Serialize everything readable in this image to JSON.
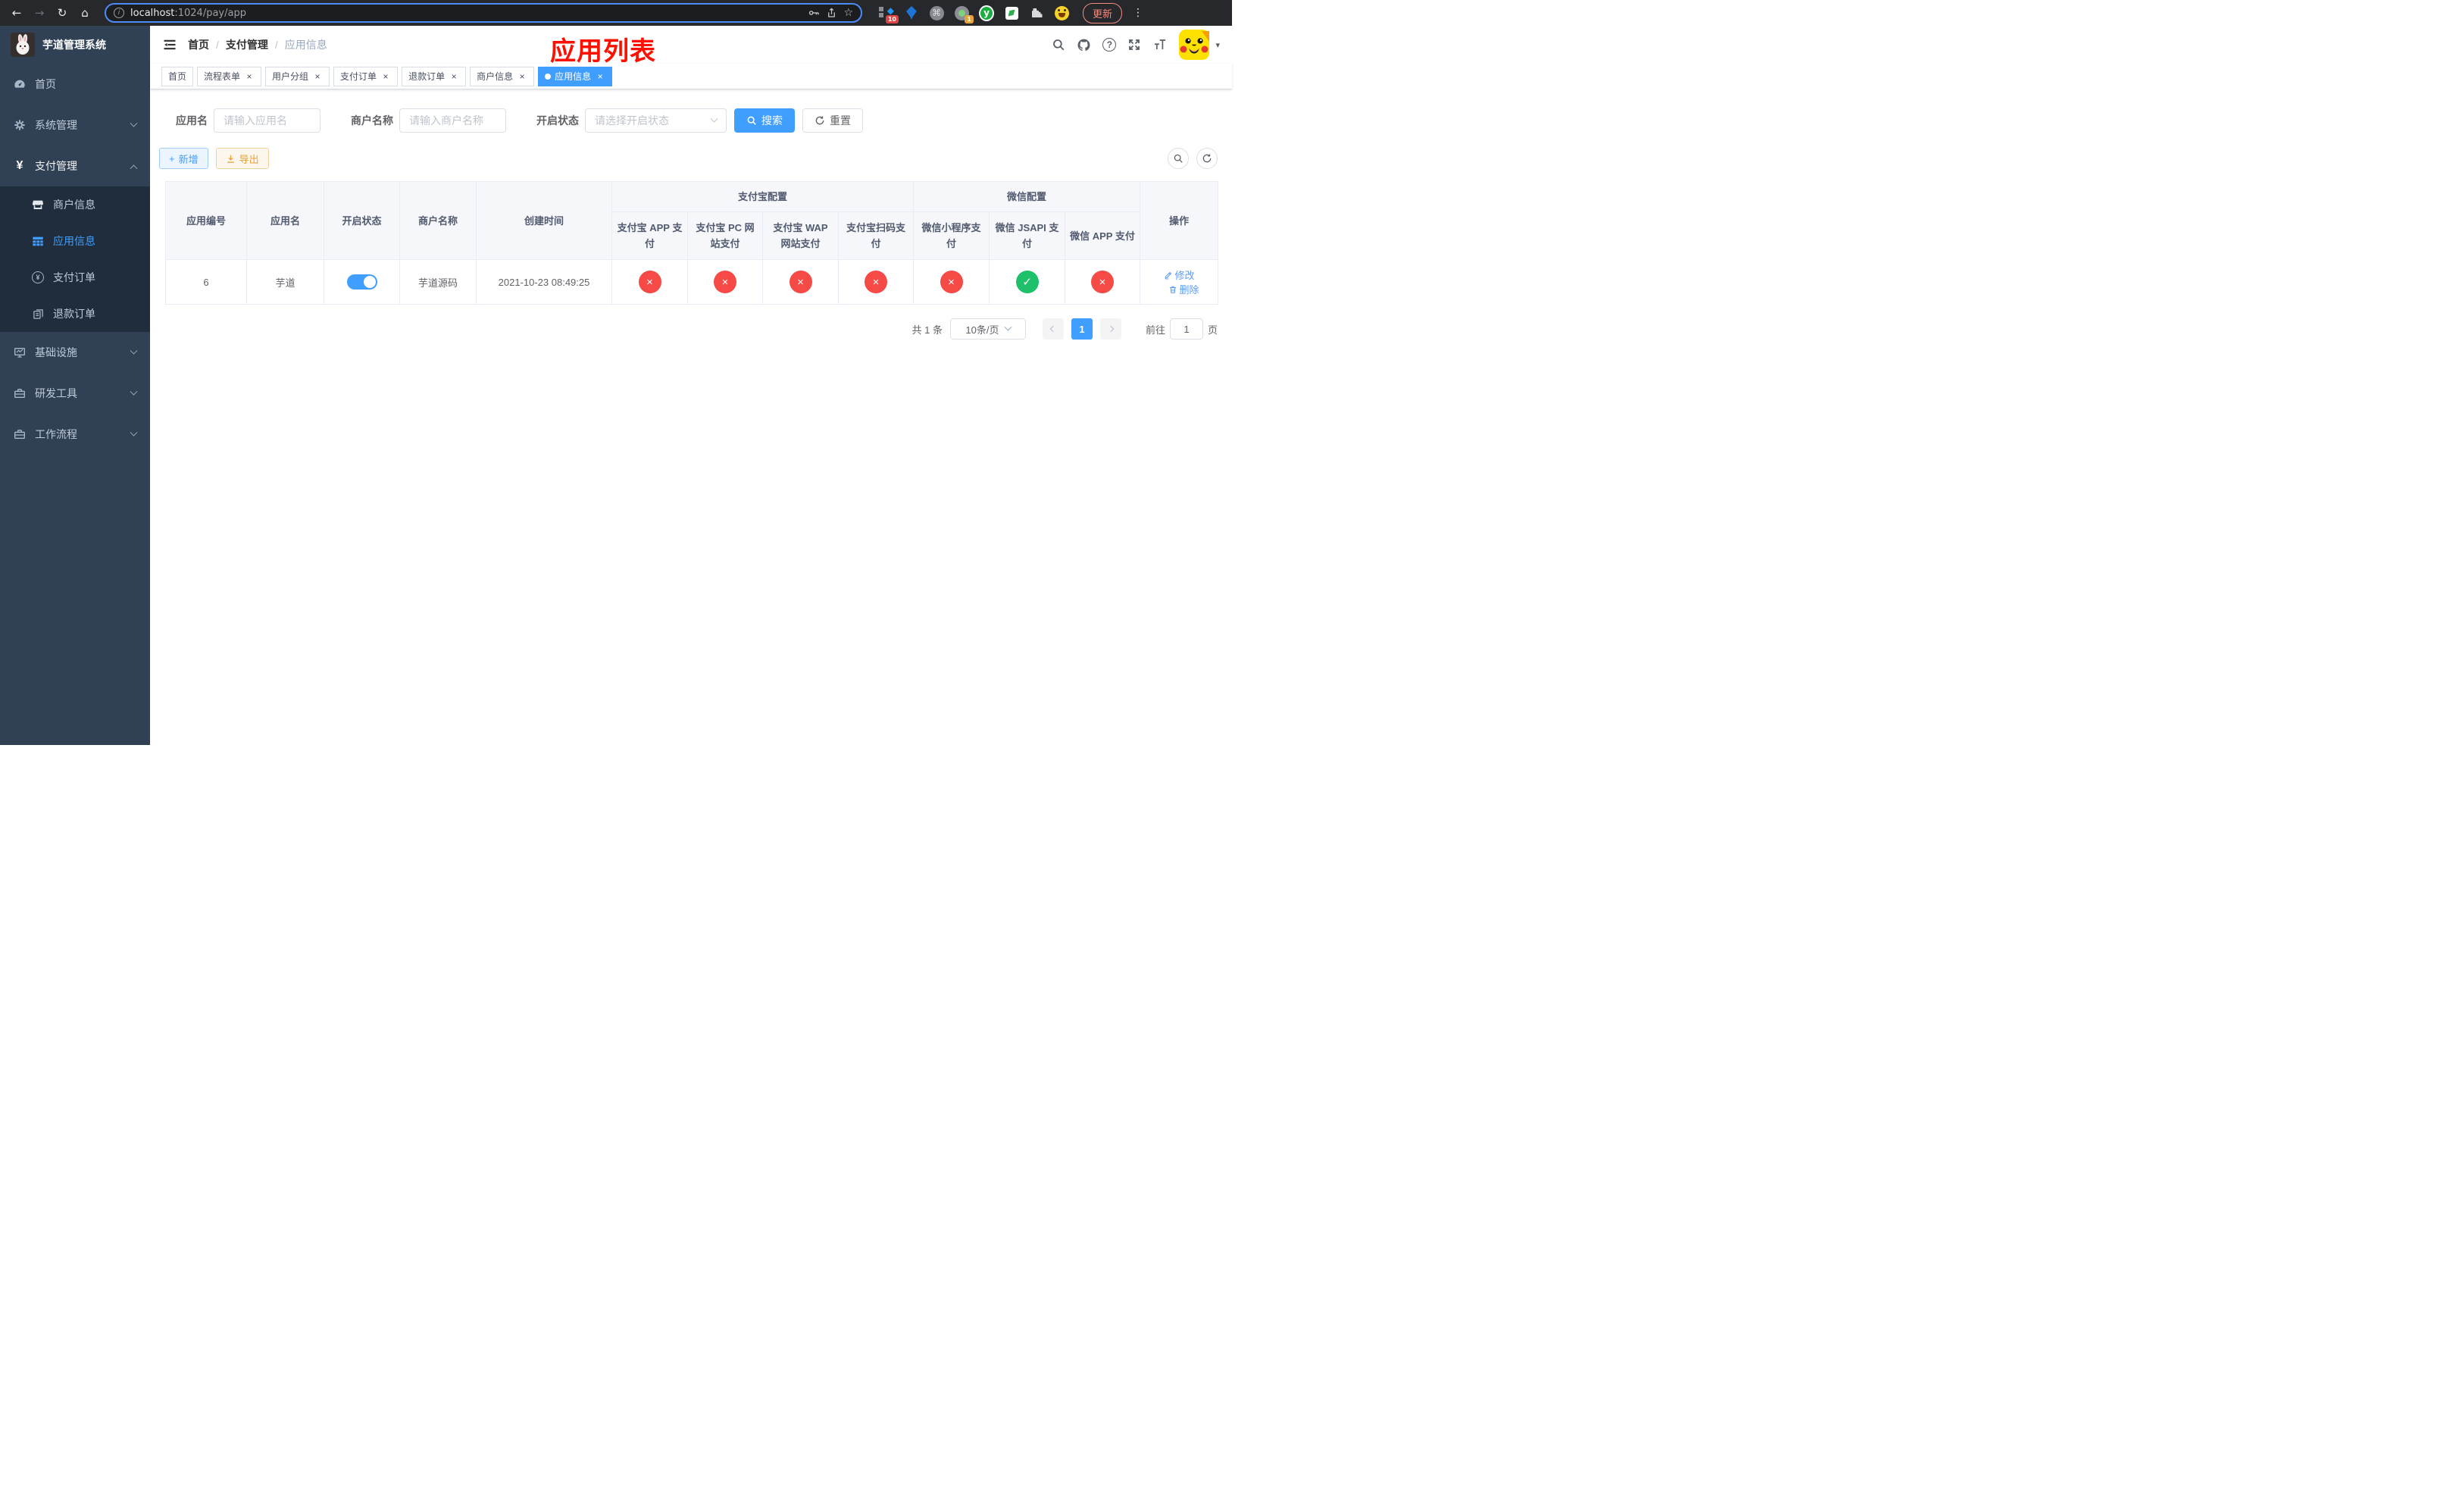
{
  "browser": {
    "url_host": "localhost",
    "url_rest": ":1024/pay/app",
    "update_label": "更新",
    "ext_badge_blue": "10",
    "ext_badge_green": "1",
    "ext_y_letter": "y"
  },
  "icons": {
    "back": "←",
    "forward": "→",
    "reload": "↻",
    "home": "⌂",
    "info": "i",
    "star": "☆",
    "kebab": "⋮",
    "command": "⌘",
    "diamond": "◆",
    "close": "×",
    "plus": "+",
    "check": "✓",
    "cross": "×",
    "caret": "▾",
    "yen": "¥",
    "question": "?"
  },
  "sidebar": {
    "title": "芋道管理系统",
    "menu": [
      {
        "label": "首页"
      },
      {
        "label": "系统管理"
      },
      {
        "label": "支付管理"
      },
      {
        "label": "商户信息"
      },
      {
        "label": "应用信息"
      },
      {
        "label": "支付订单"
      },
      {
        "label": "退款订单"
      },
      {
        "label": "基础设施"
      },
      {
        "label": "研发工具"
      },
      {
        "label": "工作流程"
      }
    ]
  },
  "header": {
    "breadcrumb": [
      "首页",
      "支付管理",
      "应用信息"
    ],
    "separator": "/",
    "annotation": "应用列表"
  },
  "tabs": [
    {
      "label": "首页"
    },
    {
      "label": "流程表单"
    },
    {
      "label": "用户分组"
    },
    {
      "label": "支付订单"
    },
    {
      "label": "退款订单"
    },
    {
      "label": "商户信息"
    },
    {
      "label": "应用信息"
    }
  ],
  "filters": {
    "app_name_label": "应用名",
    "app_name_placeholder": "请输入应用名",
    "merchant_label": "商户名称",
    "merchant_placeholder": "请输入商户名称",
    "status_label": "开启状态",
    "status_placeholder": "请选择开启状态",
    "search_label": "搜索",
    "reset_label": "重置"
  },
  "toolbar": {
    "add_label": "新增",
    "export_label": "导出"
  },
  "table": {
    "columns": {
      "id": "应用编号",
      "name": "应用名",
      "status": "开启状态",
      "merchant": "商户名称",
      "created": "创建时间",
      "actions": "操作"
    },
    "groups": {
      "alipay": "支付宝配置",
      "wechat": "微信配置"
    },
    "sub_columns": [
      "支付宝 APP 支付",
      "支付宝 PC 网站支付",
      "支付宝 WAP 网站支付",
      "支付宝扫码支付",
      "微信小程序支付",
      "微信 JSAPI 支付",
      "微信 APP 支付"
    ],
    "row": {
      "id": "6",
      "name": "芋道",
      "merchant": "芋道源码",
      "created": "2021-10-23 08:49:25",
      "statuses": [
        "fail",
        "fail",
        "fail",
        "fail",
        "fail",
        "pass",
        "fail"
      ],
      "edit_label": "修改",
      "delete_label": "删除"
    }
  },
  "pagination": {
    "total": "共 1 条",
    "page_size": "10条/页",
    "current_page": "1",
    "goto_label": "前往",
    "goto_value": "1",
    "page_unit": "页"
  }
}
